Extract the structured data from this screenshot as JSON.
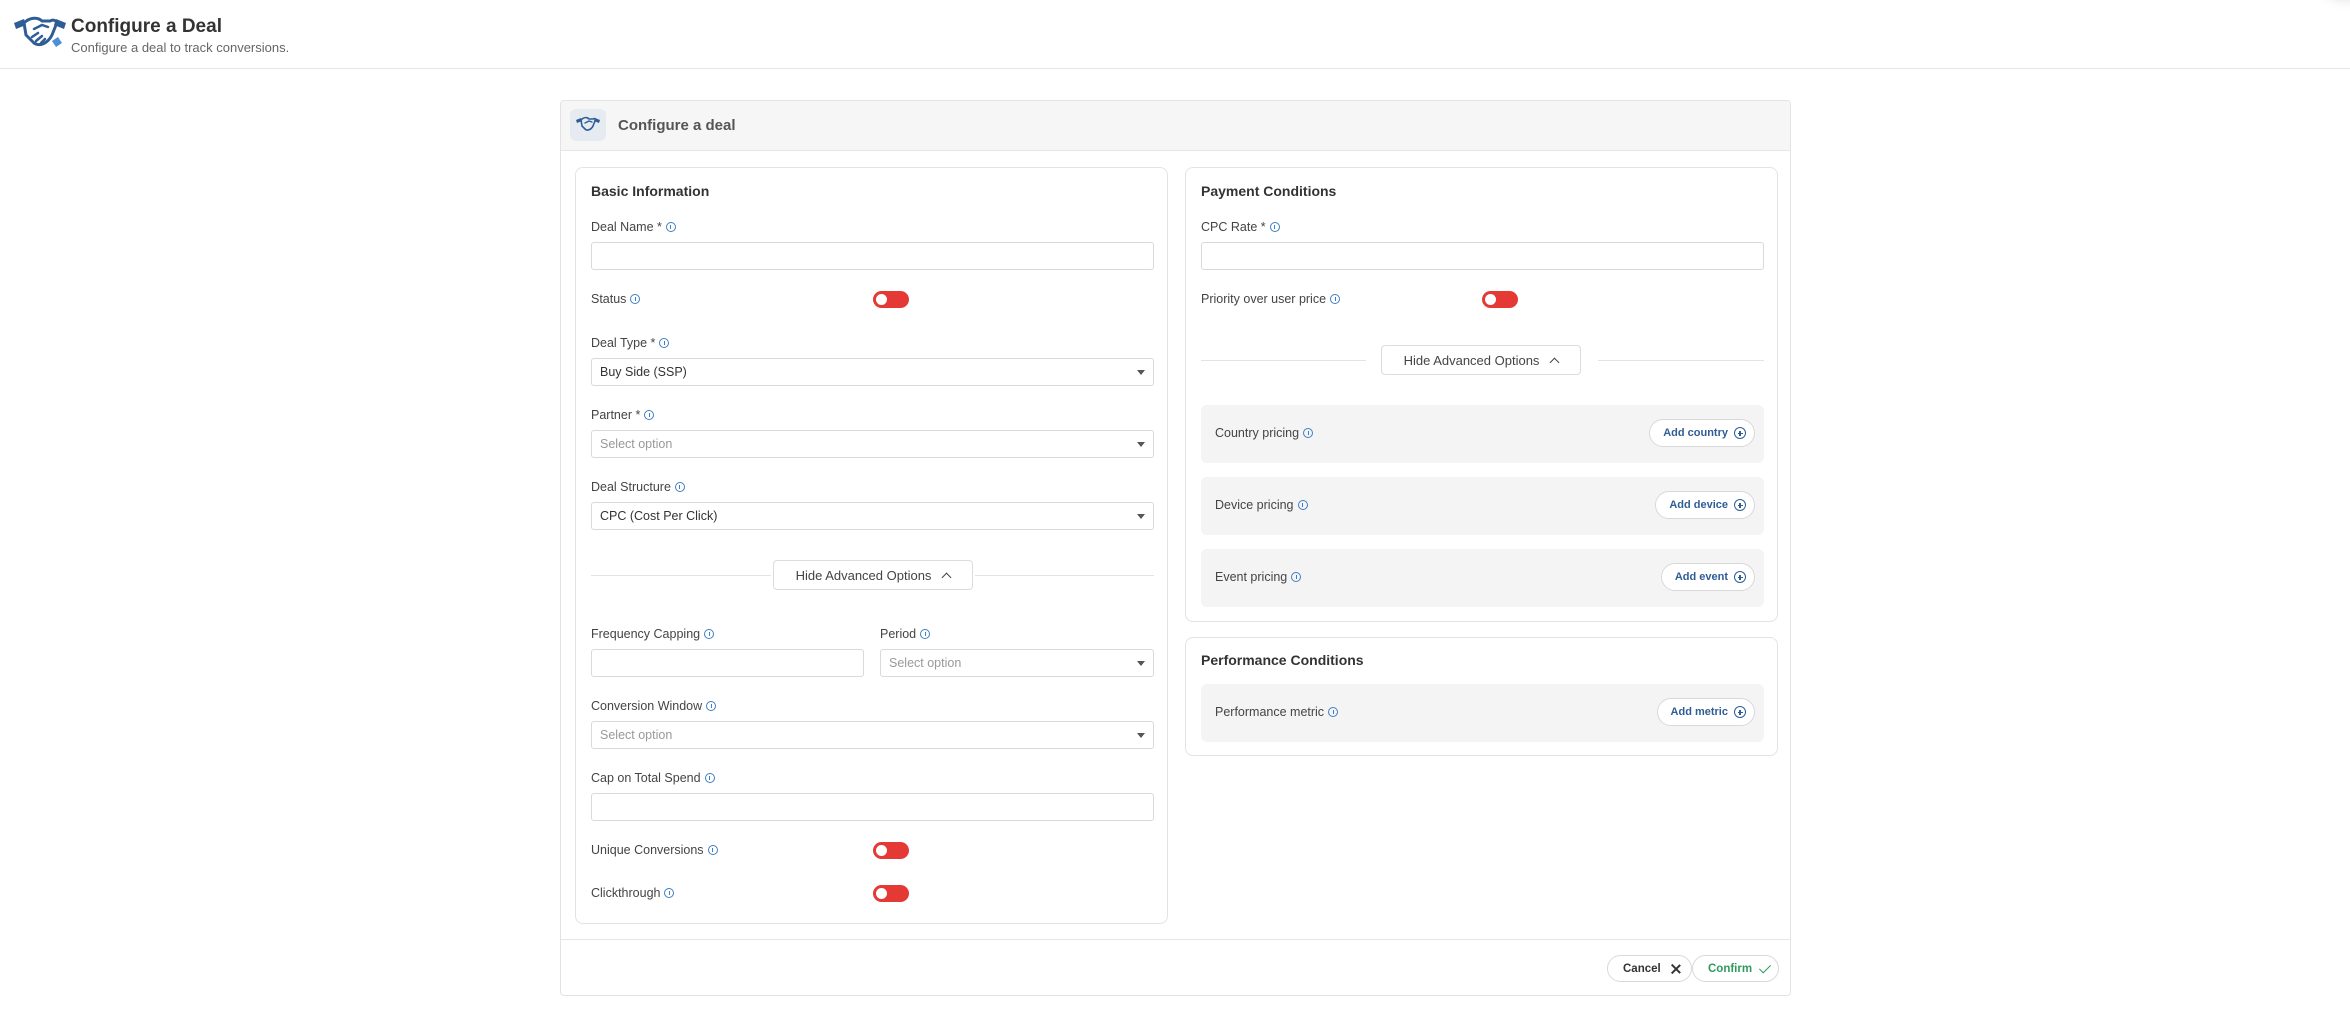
{
  "header": {
    "title": "Configure a Deal",
    "subtitle": "Configure a deal to track conversions.",
    "logo_icon": "handshake-icon"
  },
  "card": {
    "title": "Configure a deal",
    "icon": "handshake-icon"
  },
  "basic": {
    "title": "Basic Information",
    "deal_name_label": "Deal Name *",
    "deal_name_value": "",
    "status_label": "Status",
    "status_on": false,
    "deal_type_label": "Deal Type *",
    "deal_type_value": "Buy Side (SSP)",
    "partner_label": "Partner *",
    "partner_placeholder": "Select option",
    "deal_structure_label": "Deal Structure",
    "deal_structure_value": "CPC (Cost Per Click)",
    "advanced_toggle_label": "Hide Advanced Options",
    "frequency_capping_label": "Frequency Capping",
    "frequency_capping_value": "",
    "period_label": "Period",
    "period_placeholder": "Select option",
    "conversion_window_label": "Conversion Window",
    "conversion_window_placeholder": "Select option",
    "cap_total_spend_label": "Cap on Total Spend",
    "cap_total_spend_value": "",
    "unique_conversions_label": "Unique Conversions",
    "unique_conversions_on": false,
    "clickthrough_label": "Clickthrough",
    "clickthrough_on": false
  },
  "payment": {
    "title": "Payment Conditions",
    "cpc_rate_label": "CPC Rate *",
    "cpc_rate_value": "",
    "priority_label": "Priority over user price",
    "priority_on": false,
    "advanced_toggle_label": "Hide Advanced Options",
    "country_pricing_label": "Country pricing",
    "add_country_label": "Add country",
    "device_pricing_label": "Device pricing",
    "add_device_label": "Add device",
    "event_pricing_label": "Event pricing",
    "add_event_label": "Add event"
  },
  "performance": {
    "title": "Performance Conditions",
    "metric_label": "Performance metric",
    "add_metric_label": "Add metric"
  },
  "footer": {
    "cancel_label": "Cancel",
    "confirm_label": "Confirm"
  },
  "colors": {
    "toggle_off": "#e53935",
    "link_blue": "#2f5d95",
    "confirm_green": "#2e9b5b",
    "info_blue": "#3f7fc0"
  }
}
